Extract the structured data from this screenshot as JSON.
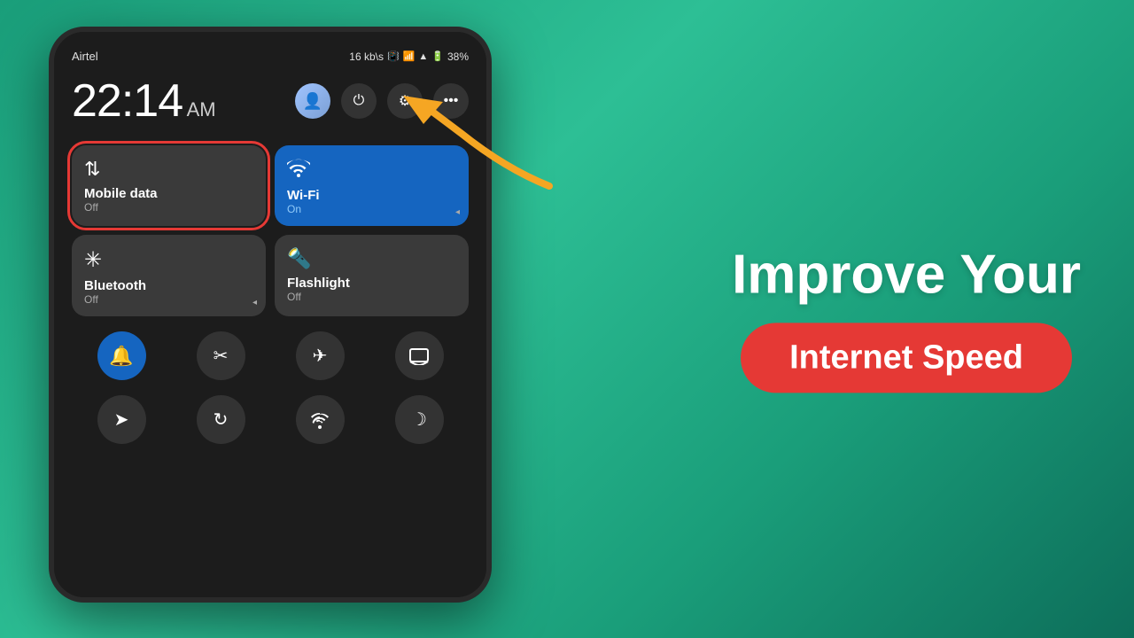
{
  "background": {
    "gradient_start": "#1a9e7a",
    "gradient_end": "#0d6e5a"
  },
  "phone": {
    "status_bar": {
      "carrier": "Airtel",
      "speed": "16 kb\\s",
      "battery_percent": "38%",
      "icons": [
        "vibrate",
        "wifi",
        "signal",
        "battery"
      ]
    },
    "time": "22:14",
    "am_pm": "AM",
    "quick_actions": [
      {
        "id": "avatar",
        "type": "avatar"
      },
      {
        "id": "power",
        "icon": "⏻"
      },
      {
        "id": "settings",
        "icon": "◎"
      },
      {
        "id": "more",
        "icon": "⋯"
      }
    ],
    "tiles": [
      {
        "id": "mobile-data",
        "title": "Mobile data",
        "subtitle": "Off",
        "active": false,
        "highlighted": true,
        "icon": "⇅"
      },
      {
        "id": "wifi",
        "title": "Wi-Fi",
        "subtitle": "On",
        "active": true,
        "highlighted": false,
        "icon": "📶"
      },
      {
        "id": "bluetooth",
        "title": "Bluetooth",
        "subtitle": "Off",
        "active": false,
        "highlighted": false,
        "icon": "✱"
      },
      {
        "id": "flashlight",
        "title": "Flashlight",
        "subtitle": "Off",
        "active": false,
        "highlighted": false,
        "icon": "🔦"
      }
    ],
    "bottom_icons_row1": [
      {
        "id": "bell",
        "icon": "🔔",
        "active": true
      },
      {
        "id": "scissors",
        "icon": "✂",
        "active": false
      },
      {
        "id": "airplane",
        "icon": "✈",
        "active": false
      },
      {
        "id": "cast",
        "icon": "▭",
        "active": false
      }
    ],
    "bottom_icons_row2": [
      {
        "id": "location",
        "icon": "➤",
        "active": false
      },
      {
        "id": "rotate",
        "icon": "↻",
        "active": false
      },
      {
        "id": "wifi2",
        "icon": "📡",
        "active": false
      },
      {
        "id": "moon",
        "icon": "☽",
        "active": false
      }
    ]
  },
  "headline": {
    "line1": "Improve Your",
    "line2": "Internet Speed"
  }
}
